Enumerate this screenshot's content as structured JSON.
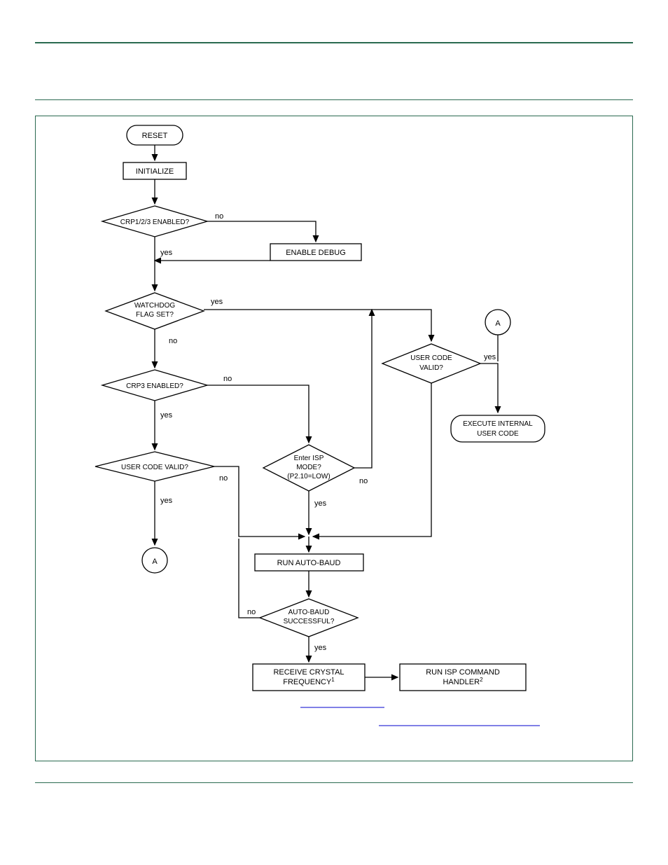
{
  "flow": {
    "reset": "RESET",
    "initialize": "INITIALIZE",
    "crp123": "CRP1/2/3 ENABLED?",
    "enable_debug": "ENABLE DEBUG",
    "watchdog_l1": "WATCHDOG",
    "watchdog_l2": "FLAG SET?",
    "crp3": "CRP3 ENABLED?",
    "user_code_valid_left": "USER CODE VALID?",
    "user_code_l1": "USER CODE",
    "user_code_l2": "VALID?",
    "exec_l1": "EXECUTE INTERNAL",
    "exec_l2": "USER CODE",
    "isp_l1": "Enter ISP",
    "isp_l2": "MODE?",
    "isp_l3": "(P2.10=LOW)",
    "run_autobaud": "RUN AUTO-BAUD",
    "autobaud_l1": "AUTO-BAUD",
    "autobaud_l2": "SUCCESSFUL?",
    "recv_l1": "RECEIVE CRYSTAL",
    "recv_l2_pre": "FREQUENCY",
    "recv_l2_sup": "1",
    "run_isp_l1": "RUN ISP COMMAND",
    "run_isp_l2_pre": "HANDLER",
    "run_isp_l2_sup": "2",
    "connA": "A",
    "yes": "yes",
    "no": "no"
  }
}
